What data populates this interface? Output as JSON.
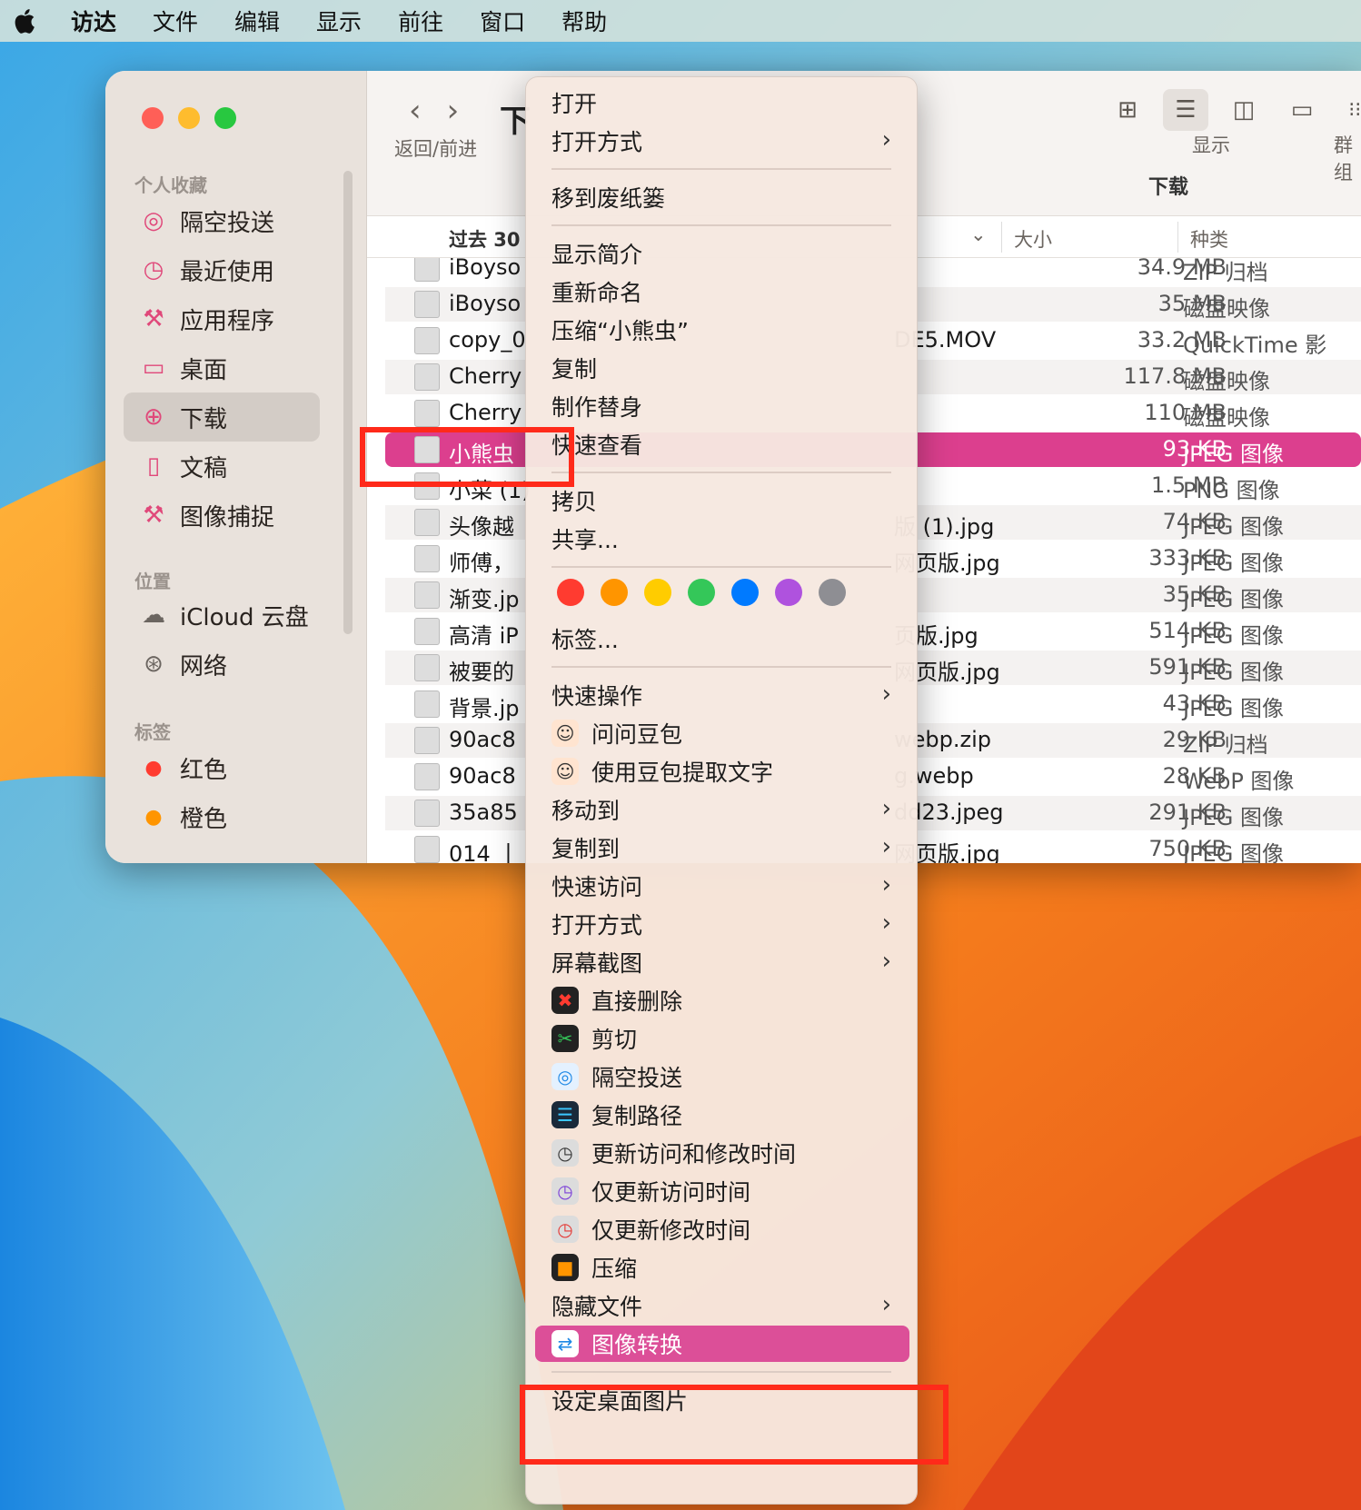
{
  "menubar": {
    "items": [
      "访达",
      "文件",
      "编辑",
      "显示",
      "前往",
      "窗口",
      "帮助"
    ]
  },
  "sidebar": {
    "favorites_title": "个人收藏",
    "favorites": [
      "隔空投送",
      "最近使用",
      "应用程序",
      "桌面",
      "下载",
      "文稿",
      "图像捕捉"
    ],
    "locations_title": "位置",
    "locations": [
      "iCloud 云盘",
      "网络"
    ],
    "tags_title": "标签",
    "tags": [
      {
        "label": "红色",
        "color": "#ff3b30"
      },
      {
        "label": "橙色",
        "color": "#ff9500"
      }
    ]
  },
  "toolbar": {
    "nav_label": "返回/前进",
    "title_fragment": "下",
    "view_label": "显示",
    "group_label": "群组",
    "location_title": "下载"
  },
  "columns": {
    "name_fragment": "过去 30",
    "size": "大小",
    "kind": "种类"
  },
  "files": [
    {
      "name": "iBoyso",
      "tail": "",
      "size": "34.9 MB",
      "kind": "ZIP 归档"
    },
    {
      "name": "iBoyso",
      "tail": "",
      "size": "35 MB",
      "kind": "磁盘映像"
    },
    {
      "name": "copy_0",
      "tail": "DE5.MOV",
      "size": "33.2 MB",
      "kind": "QuickTime 影"
    },
    {
      "name": "Cherry",
      "tail": "",
      "size": "117.8 MB",
      "kind": "磁盘映像"
    },
    {
      "name": "Cherry",
      "tail": "",
      "size": "110 MB",
      "kind": "磁盘映像"
    },
    {
      "name": "小熊虫",
      "tail": "",
      "size": "93 KB",
      "kind": "JPEG 图像"
    },
    {
      "name": "小菜 (1)",
      "tail": "",
      "size": "1.5 MB",
      "kind": "PNG 图像"
    },
    {
      "name": "头像越",
      "tail": "版 (1).jpg",
      "size": "74 KB",
      "kind": "JPEG 图像"
    },
    {
      "name": "师傅，",
      "tail": "网页版.jpg",
      "size": "333 KB",
      "kind": "JPEG 图像"
    },
    {
      "name": "渐变.jp",
      "tail": "",
      "size": "35 KB",
      "kind": "JPEG 图像"
    },
    {
      "name": "高清 iP",
      "tail": "页版.jpg",
      "size": "514 KB",
      "kind": "JPEG 图像"
    },
    {
      "name": "被要的",
      "tail": "网页版.jpg",
      "size": "591 KB",
      "kind": "JPEG 图像"
    },
    {
      "name": "背景.jp",
      "tail": "",
      "size": "43 KB",
      "kind": "JPEG 图像"
    },
    {
      "name": "90ac8",
      "tail": "webp.zip",
      "size": "29 KB",
      "kind": "ZIP 归档"
    },
    {
      "name": "90ac8",
      "tail": "g.webp",
      "size": "28 KB",
      "kind": "WebP 图像"
    },
    {
      "name": "35a85",
      "tail": "dd23.jpeg",
      "size": "291 KB",
      "kind": "JPEG 图像"
    },
    {
      "name": "014 丨",
      "tail": "网页版.jpg",
      "size": "750 KB",
      "kind": "JPEG 图像"
    }
  ],
  "context_menu": {
    "open": "打开",
    "open_with": "打开方式",
    "trash": "移到废纸篓",
    "get_info": "显示简介",
    "rename": "重新命名",
    "compress": "压缩“小熊虫”",
    "duplicate": "复制",
    "make_alias": "制作替身",
    "quick_look": "快速查看",
    "copy": "拷贝",
    "share": "共享...",
    "tag_colors": [
      "#ff3b30",
      "#ff9500",
      "#ffcc00",
      "#34c759",
      "#007aff",
      "#af52de",
      "#8e8e93"
    ],
    "tags": "标签...",
    "quick_actions": "快速操作",
    "ask_doubao": "问问豆包",
    "doubao_extract": "使用豆包提取文字",
    "move_to": "移动到",
    "copy_to": "复制到",
    "quick_access": "快速访问",
    "open_with2": "打开方式",
    "screenshot": "屏幕截图",
    "delete_direct": "直接删除",
    "cut": "剪切",
    "airdrop": "隔空投送",
    "copy_path": "复制路径",
    "update_times": "更新访问和修改时间",
    "update_access": "仅更新访问时间",
    "update_modify": "仅更新修改时间",
    "compress2": "压缩",
    "hide_files": "隐藏文件",
    "image_convert": "图像转换",
    "set_wallpaper": "设定桌面图片"
  }
}
